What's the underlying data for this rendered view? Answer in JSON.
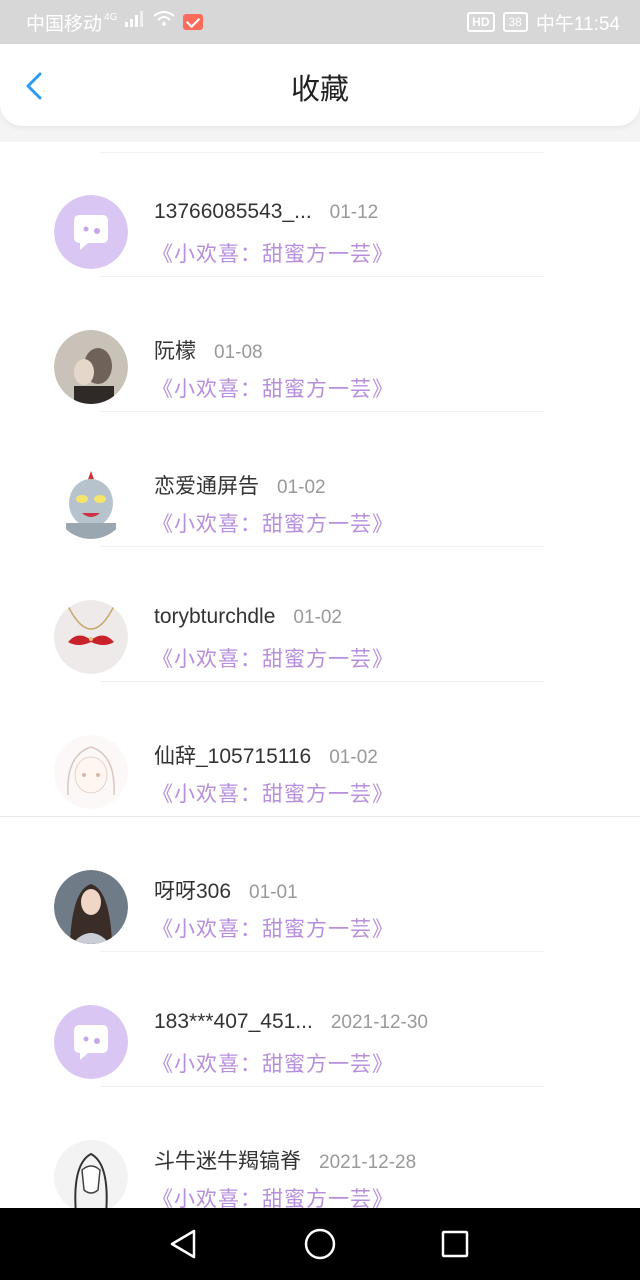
{
  "status_bar": {
    "carrier": "中国移动",
    "network": "4G",
    "hd": "HD",
    "battery": "38",
    "time": "中午11:54"
  },
  "header": {
    "title": "收藏"
  },
  "items": [
    {
      "name": "13766085543_...",
      "date": "01-12",
      "book": "《小欢喜：甜蜜方一芸》",
      "avatar": "chat-bubble-avatar"
    },
    {
      "name": "阮檬",
      "date": "01-08",
      "book": "《小欢喜：甜蜜方一芸》",
      "avatar": "photo-avatar"
    },
    {
      "name": "恋爱通屏告",
      "date": "01-02",
      "book": "《小欢喜：甜蜜方一芸》",
      "avatar": "ultraman-avatar"
    },
    {
      "name": "torybturchdle",
      "date": "01-02",
      "book": "《小欢喜：甜蜜方一芸》",
      "avatar": "mustache-necklace-avatar"
    },
    {
      "name": "仙辞_105715116",
      "date": "01-02",
      "book": "《小欢喜：甜蜜方一芸》",
      "avatar": "anime-sketch-avatar"
    },
    {
      "name": "呀呀306",
      "date": "01-01",
      "book": "《小欢喜：甜蜜方一芸》",
      "avatar": "photo-avatar"
    },
    {
      "name": "183***407_451...",
      "date": "2021-12-30",
      "book": "《小欢喜：甜蜜方一芸》",
      "avatar": "chat-bubble-avatar"
    },
    {
      "name": "斗牛迷牛羯镐脊",
      "date": "2021-12-28",
      "book": "《小欢喜：甜蜜方一芸》",
      "avatar": "sketch-avatar"
    }
  ],
  "colors": {
    "accent": "#2b9af3",
    "book_title": "#b78fdc",
    "avatar_purple": "#d9c6f2"
  }
}
